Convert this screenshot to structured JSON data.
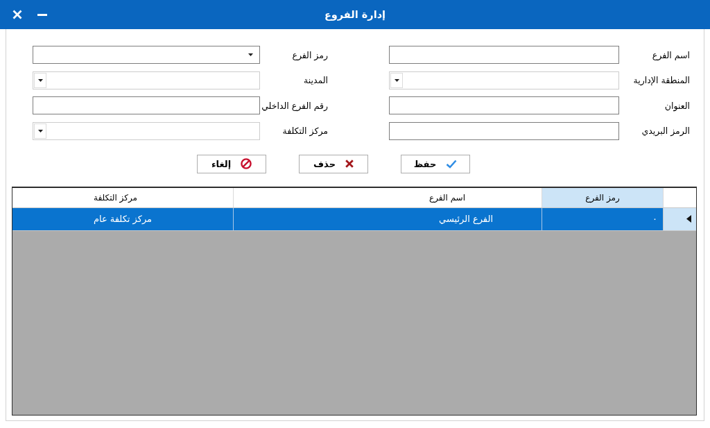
{
  "window": {
    "title": "إدارة الفروع"
  },
  "form": {
    "fields": [
      {
        "label": "اسم الفرع",
        "kind": "text"
      },
      {
        "label": "رمز الفرع",
        "kind": "dropdown"
      },
      {
        "label": "المنطقة الإدارية",
        "kind": "combo"
      },
      {
        "label": "المدينة",
        "kind": "combo"
      },
      {
        "label": "العنوان",
        "kind": "text"
      },
      {
        "label": "رقم الفرع الداخلي",
        "kind": "text"
      },
      {
        "label": "الرمز البريدي",
        "kind": "text"
      },
      {
        "label": "مركز التكلفة",
        "kind": "combo"
      }
    ]
  },
  "buttons": [
    {
      "label": "حفظ",
      "kind": "save"
    },
    {
      "label": "حذف",
      "kind": "delete"
    },
    {
      "label": "إلغاء",
      "kind": "cancel"
    }
  ],
  "table": {
    "columns": [
      {
        "label": "رمز الفرع",
        "selected": true
      },
      {
        "label": "اسم الفرع",
        "selected": false
      },
      {
        "label": "مركز التكلفة",
        "selected": false
      }
    ],
    "rows": [
      {
        "selected": true,
        "cells": [
          "٠",
          "الفرع الرئيسي",
          "مركز تكلفة عام"
        ]
      }
    ]
  }
}
